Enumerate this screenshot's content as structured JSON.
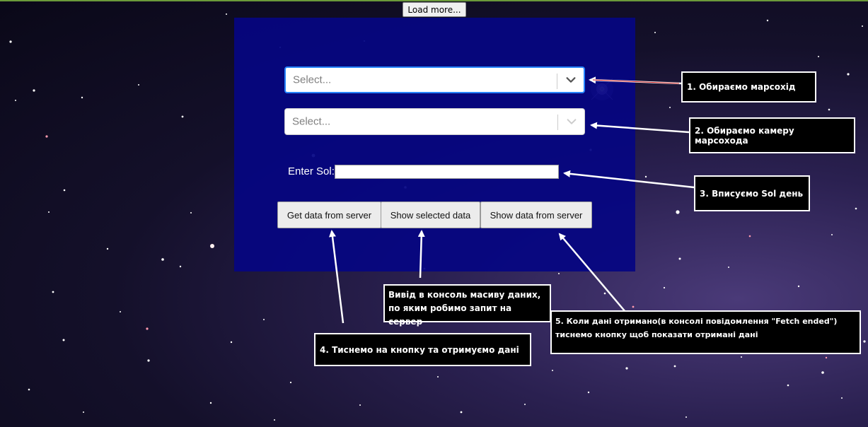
{
  "toolbar": {
    "load_more_label": "Load more..."
  },
  "form": {
    "rover_select": {
      "placeholder": "Select..."
    },
    "camera_select": {
      "placeholder": "Select..."
    },
    "sol": {
      "label": "Enter Sol:",
      "value": ""
    },
    "buttons": {
      "get_data": "Get data from server",
      "show_selected": "Show selected data",
      "show_data": "Show data from server"
    }
  },
  "annotations": {
    "step1": "1. Обираємо марсохід",
    "step2": "2. Обираємо камеру марсохода",
    "step3": "3. Вписуємо Sol день",
    "step4": "4. Тиснемо на кнопку та отримуємо дані",
    "step5_line1": "5. Коли дані отримано(в консолі повідомлення \"Fetch ended\")",
    "step5_line2": "тиснемо кнопку щоб показати отримані дані",
    "console_line1": "Вивід в консоль масиву даних,",
    "console_line2": "по яким робимо запит на сервер"
  },
  "colors": {
    "panel": "#050582",
    "focus_border": "#2684ff",
    "annotation_bg": "#000000",
    "annotation_border": "#ffffff"
  }
}
